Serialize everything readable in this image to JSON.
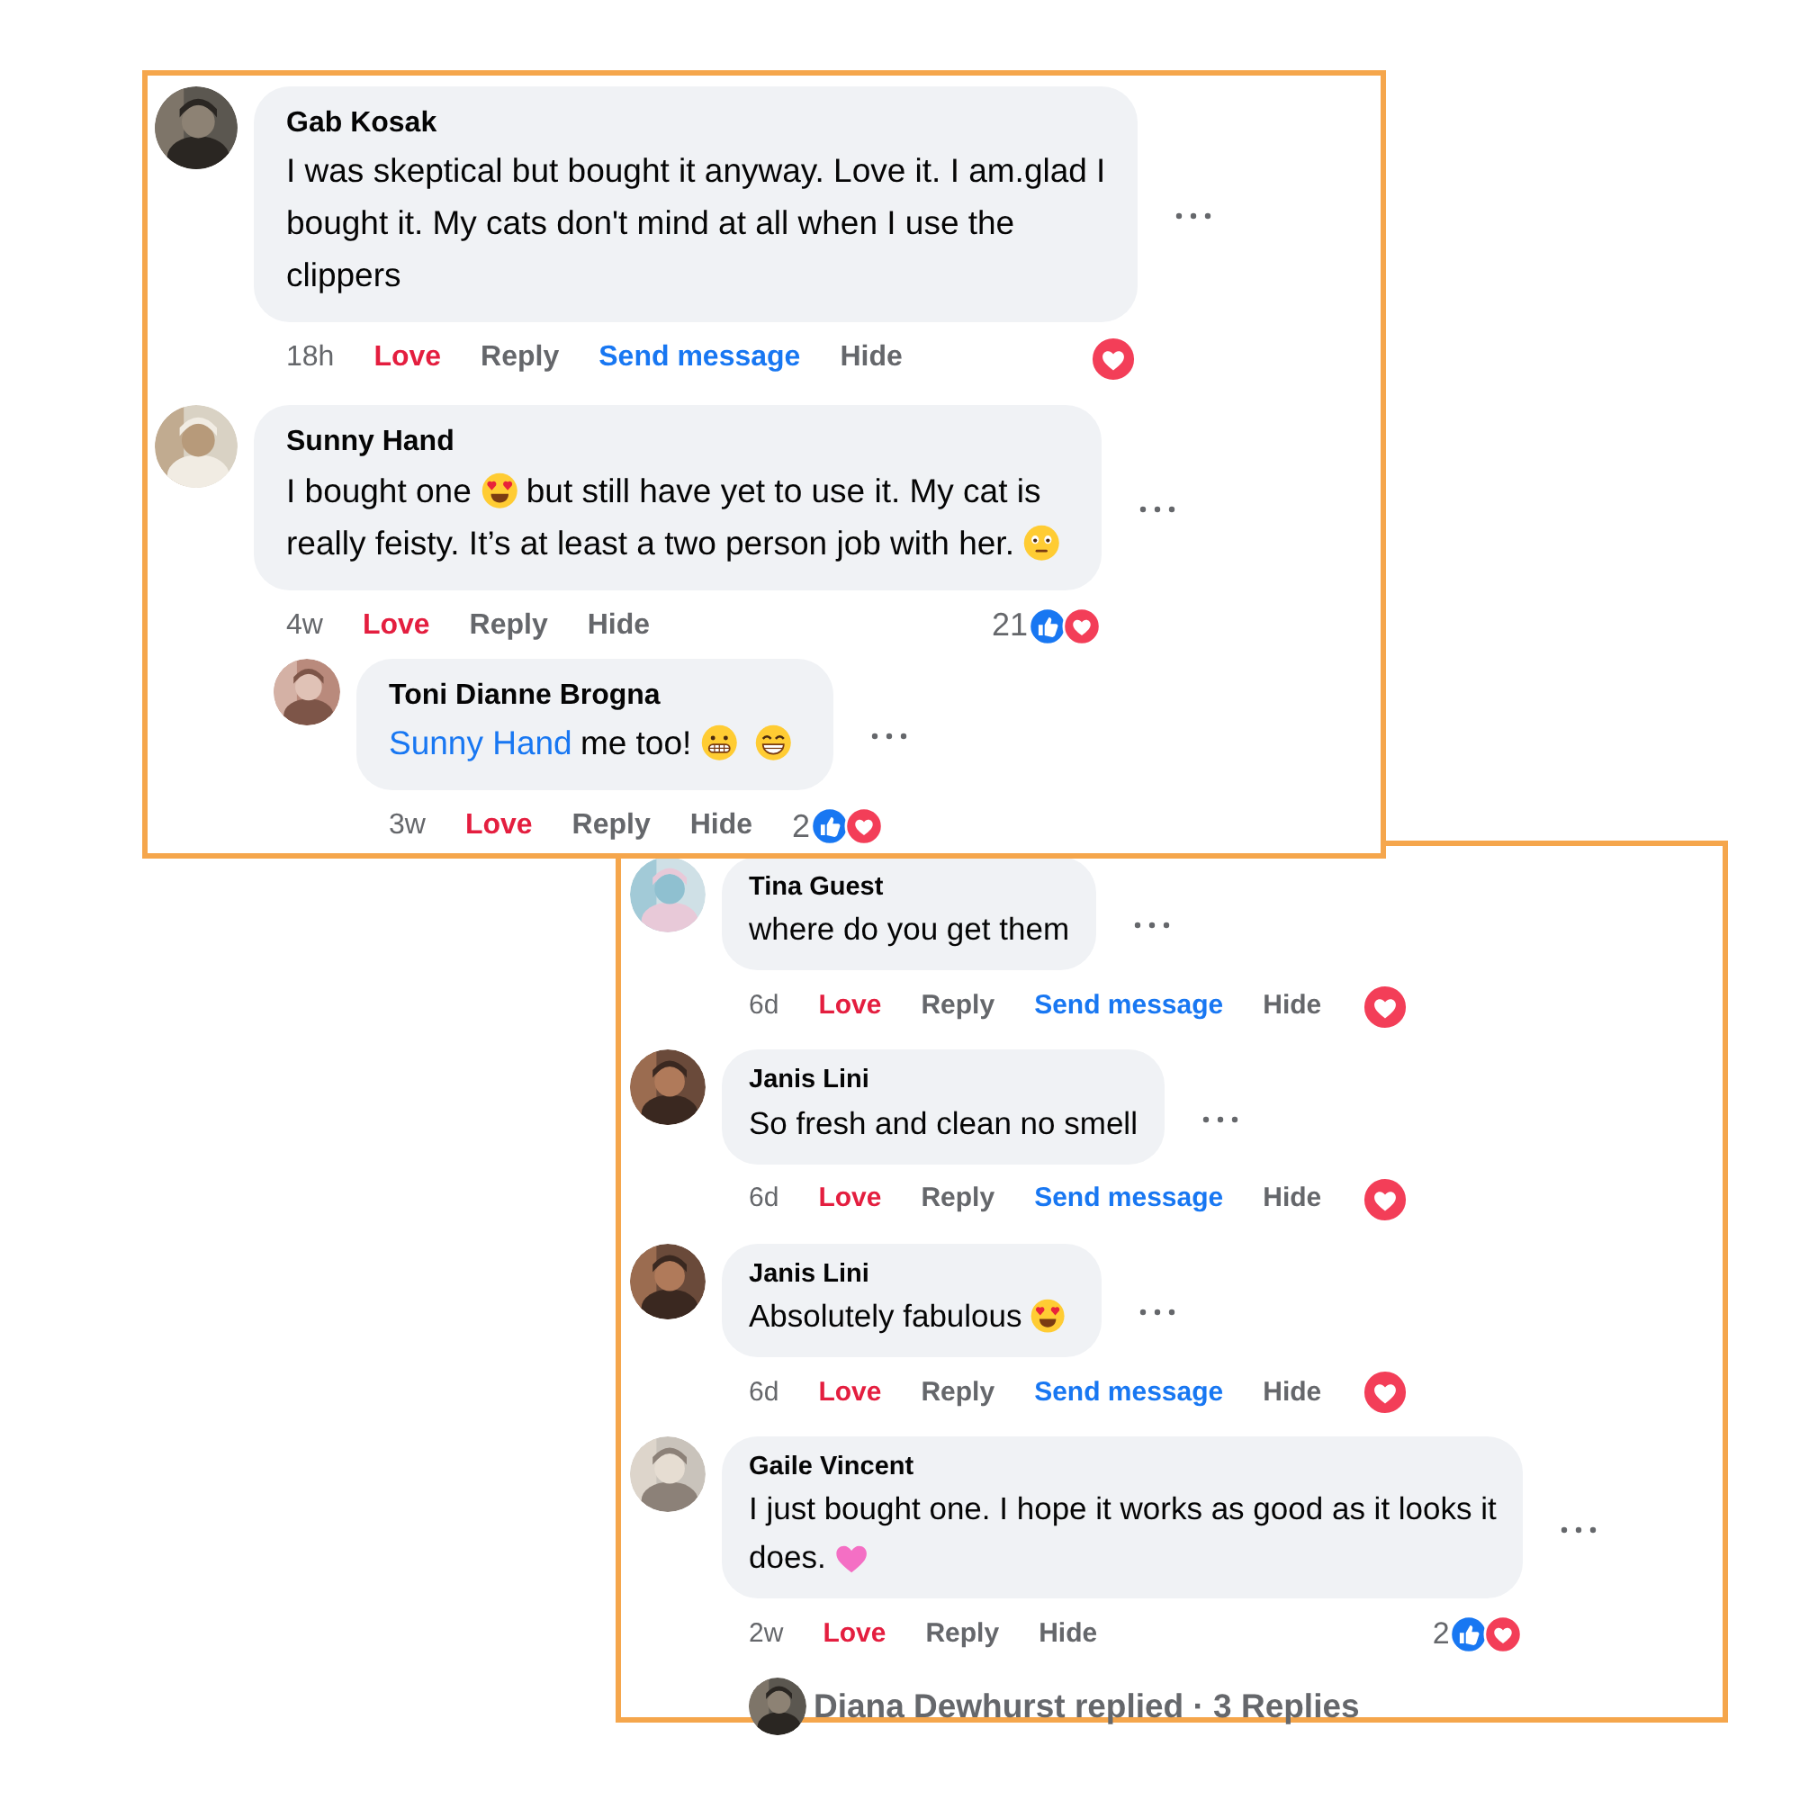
{
  "panels": [
    {
      "comments": [
        {
          "author": "Gab Kosak",
          "lines": [
            [
              {
                "kind": "text",
                "text": "I was skeptical but bought it anyway. Love it. I am.glad I"
              }
            ],
            [
              {
                "kind": "text",
                "text": "bought it. My cats don't mind at all when I use the"
              }
            ],
            [
              {
                "kind": "text",
                "text": "clippers"
              }
            ]
          ],
          "time": "18h",
          "reacted": true,
          "actions": [
            {
              "kind": "react",
              "label": "Love"
            },
            {
              "kind": "reply",
              "label": "Reply"
            },
            {
              "kind": "message",
              "label": "Send message"
            },
            {
              "kind": "hide",
              "label": "Hide"
            }
          ],
          "reactions": {
            "love": true
          }
        },
        {
          "author": "Sunny Hand",
          "lines": [
            [
              {
                "kind": "text",
                "text": "I bought one"
              },
              {
                "kind": "hearteyes"
              },
              {
                "kind": "text",
                "text": "but still have yet to use it. My cat is"
              }
            ],
            [
              {
                "kind": "text",
                "text": "really feisty. It’s at least a two person job with her."
              },
              {
                "kind": "flushed"
              }
            ]
          ],
          "time": "4w",
          "reacted": true,
          "actions": [
            {
              "kind": "react",
              "label": "Love"
            },
            {
              "kind": "reply",
              "label": "Reply"
            },
            {
              "kind": "hide",
              "label": "Hide"
            }
          ],
          "reactions": {
            "count": "21",
            "like": true,
            "love": true
          },
          "replies": [
            {
              "author": "Toni Dianne Brogna",
              "lines": [
                [
                  {
                    "kind": "mention",
                    "text": "Sunny Hand"
                  },
                  {
                    "kind": "text",
                    "text": "me too!"
                  },
                  {
                    "kind": "grimace"
                  },
                  {
                    "kind": "grin"
                  }
                ]
              ],
              "time": "3w",
              "reacted": true,
              "actions": [
                {
                  "kind": "react",
                  "label": "Love"
                },
                {
                  "kind": "reply",
                  "label": "Reply"
                },
                {
                  "kind": "hide",
                  "label": "Hide"
                }
              ],
              "reactions": {
                "count": "2",
                "like": true,
                "love": true
              }
            }
          ]
        }
      ]
    },
    {
      "comments": [
        {
          "author": "Tina Guest",
          "lines": [
            [
              {
                "kind": "text",
                "text": "where do you get them"
              }
            ]
          ],
          "time": "6d",
          "reacted": true,
          "actions": [
            {
              "kind": "react",
              "label": "Love"
            },
            {
              "kind": "reply",
              "label": "Reply"
            },
            {
              "kind": "message",
              "label": "Send message"
            },
            {
              "kind": "hide",
              "label": "Hide"
            }
          ],
          "reactions": {
            "love": true
          }
        },
        {
          "author": "Janis Lini",
          "lines": [
            [
              {
                "kind": "text",
                "text": "So fresh and clean no smell"
              }
            ]
          ],
          "time": "6d",
          "reacted": true,
          "actions": [
            {
              "kind": "react",
              "label": "Love"
            },
            {
              "kind": "reply",
              "label": "Reply"
            },
            {
              "kind": "message",
              "label": "Send message"
            },
            {
              "kind": "hide",
              "label": "Hide"
            }
          ],
          "reactions": {
            "love": true
          }
        },
        {
          "author": "Janis Lini",
          "lines": [
            [
              {
                "kind": "text",
                "text": "Absolutely fabulous"
              },
              {
                "kind": "hearteyes"
              }
            ]
          ],
          "time": "6d",
          "reacted": true,
          "actions": [
            {
              "kind": "react",
              "label": "Love"
            },
            {
              "kind": "reply",
              "label": "Reply"
            },
            {
              "kind": "message",
              "label": "Send message"
            },
            {
              "kind": "hide",
              "label": "Hide"
            }
          ],
          "reactions": {
            "love": true
          }
        },
        {
          "author": "Gaile Vincent",
          "lines": [
            [
              {
                "kind": "text",
                "text": "I just bought one. I hope it works as good as it looks it"
              }
            ],
            [
              {
                "kind": "text",
                "text": "does."
              },
              {
                "kind": "heart"
              }
            ]
          ],
          "time": "2w",
          "reacted": true,
          "actions": [
            {
              "kind": "react",
              "label": "Love"
            },
            {
              "kind": "reply",
              "label": "Reply"
            },
            {
              "kind": "hide",
              "label": "Hide"
            }
          ],
          "reactions": {
            "count": "2",
            "like": true,
            "love": true
          }
        }
      ],
      "footer": {
        "text": "Diana Dewhurst replied · 3 Replies"
      }
    }
  ]
}
